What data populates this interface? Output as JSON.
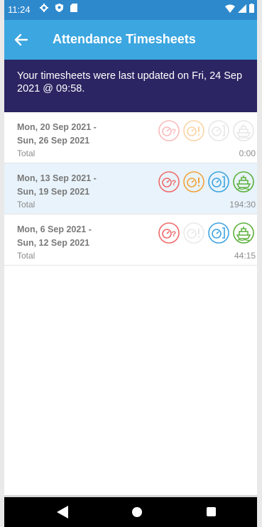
{
  "status_bar": {
    "time": "11:24"
  },
  "appbar": {
    "title": "Attendance Timesheets"
  },
  "banner": {
    "text": "Your timesheets were last updated on Fri, 24 Sep 2021 @ 09:58."
  },
  "timesheets": [
    {
      "date_range_line1": "Mon, 20 Sep 2021 -",
      "date_range_line2": "Sun, 26 Sep 2021",
      "total_label": "Total",
      "total_value": "0:00",
      "selected": false,
      "icons": [
        {
          "name": "timer-question-icon",
          "color": "#f06b6b",
          "faded": true
        },
        {
          "name": "timer-alert-icon",
          "color": "#f2a33b",
          "faded": true
        },
        {
          "name": "timer-check-icon",
          "color": "#c8c8c8",
          "faded": true
        },
        {
          "name": "ship-icon",
          "color": "#c8c8c8",
          "faded": true
        }
      ]
    },
    {
      "date_range_line1": "Mon, 13 Sep 2021 -",
      "date_range_line2": "Sun, 19 Sep 2021",
      "total_label": "Total",
      "total_value": "194:30",
      "selected": true,
      "icons": [
        {
          "name": "timer-question-icon",
          "color": "#f06b6b",
          "faded": false
        },
        {
          "name": "timer-alert-icon",
          "color": "#f2a33b",
          "faded": false
        },
        {
          "name": "timer-check-icon",
          "color": "#3da4e0",
          "faded": false
        },
        {
          "name": "ship-icon",
          "color": "#5bb03a",
          "faded": false
        }
      ]
    },
    {
      "date_range_line1": "Mon, 6 Sep 2021 -",
      "date_range_line2": "Sun, 12 Sep 2021",
      "total_label": "Total",
      "total_value": "44:15",
      "selected": false,
      "icons": [
        {
          "name": "timer-question-icon",
          "color": "#f06b6b",
          "faded": false
        },
        {
          "name": "timer-alert-icon",
          "color": "#d0d0d0",
          "faded": true
        },
        {
          "name": "timer-check-icon",
          "color": "#3da4e0",
          "faded": false
        },
        {
          "name": "ship-icon",
          "color": "#5bb03a",
          "faded": false
        }
      ]
    }
  ],
  "colors": {
    "statusbar": "#2e89cc",
    "appbar": "#3ca6e0",
    "banner": "#2b2563",
    "selected_row": "#e8f3fb"
  }
}
